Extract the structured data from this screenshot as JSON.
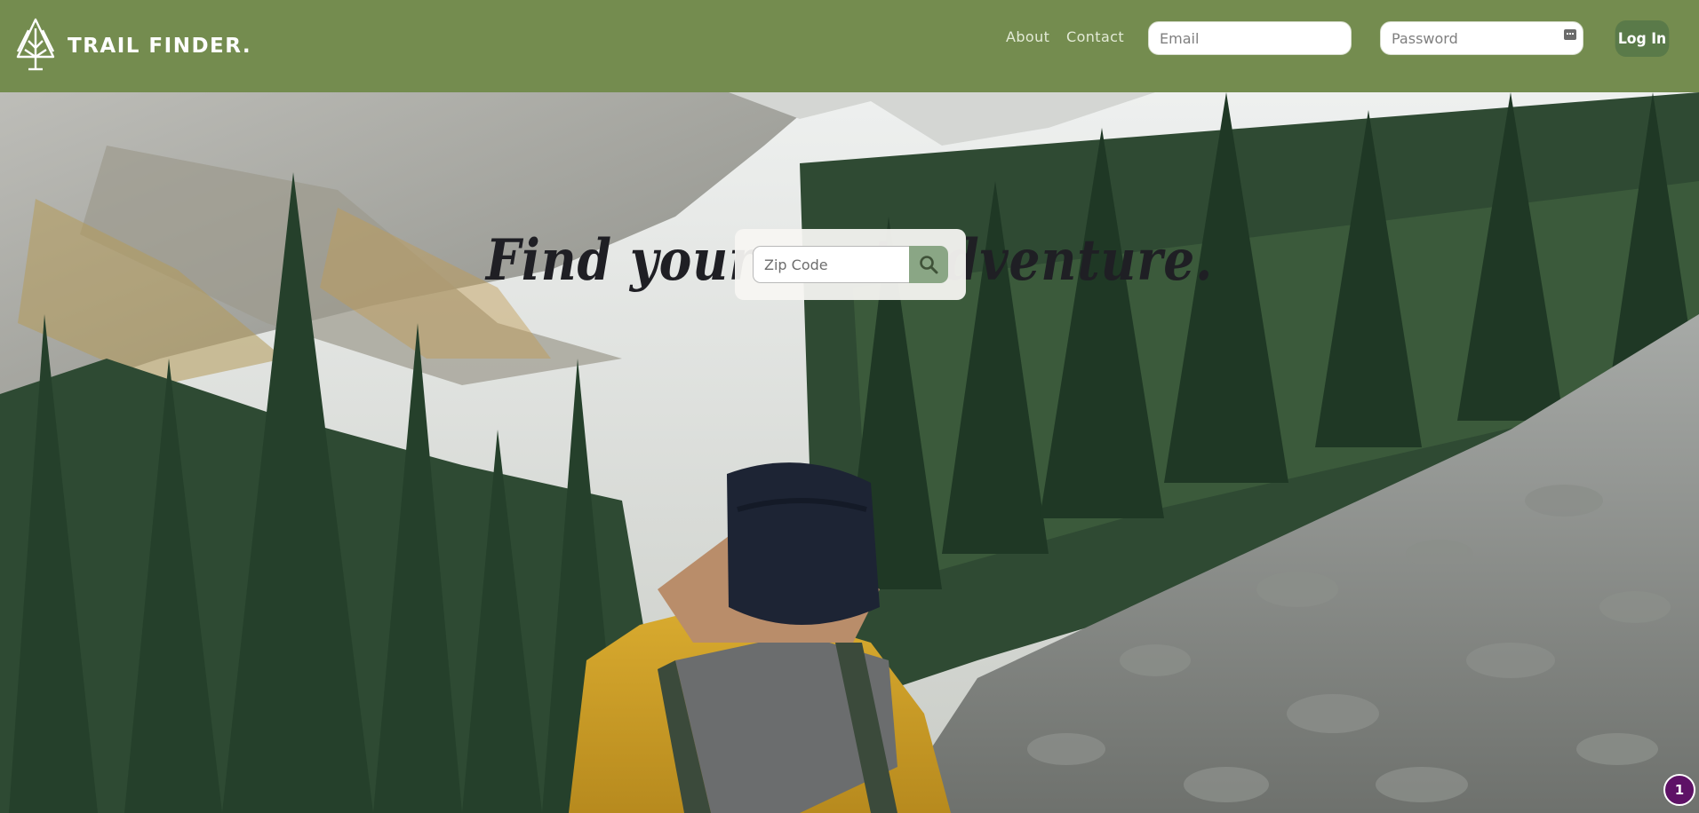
{
  "brand": {
    "name": "TRAIL FINDER.",
    "logo_icon": "trees-logo-icon"
  },
  "nav": {
    "about": "About",
    "contact": "Contact"
  },
  "login": {
    "email_placeholder": "Email",
    "password_placeholder": "Password",
    "password_manager_icon": "key-icon",
    "button_label": "Log In"
  },
  "hero": {
    "headline": "Find your next adventure.",
    "image_subject": "hiker-mountain-forest-photo",
    "zip_placeholder": "Zip Code",
    "search_icon": "magnifier-icon"
  },
  "notification": {
    "count": "1"
  },
  "colors": {
    "header_bg": "#748c4f",
    "login_button": "#5a7a49",
    "search_button": "#8aa685",
    "badge": "#5e1266"
  }
}
